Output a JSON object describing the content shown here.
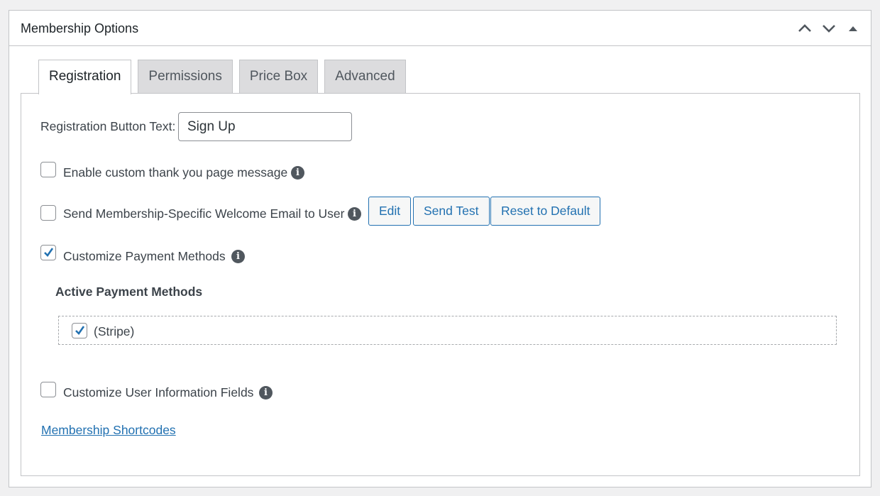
{
  "metabox": {
    "title": "Membership Options",
    "controls": [
      "move-up",
      "move-down",
      "toggle-panel"
    ]
  },
  "tabs": [
    {
      "label": "Registration",
      "active": true
    },
    {
      "label": "Permissions",
      "active": false
    },
    {
      "label": "Price Box",
      "active": false
    },
    {
      "label": "Advanced",
      "active": false
    }
  ],
  "registration": {
    "button_text_label": "Registration Button Text:",
    "button_text_value": "Sign Up",
    "thank_you": {
      "label": "Enable custom thank you page message",
      "checked": false
    },
    "welcome_email": {
      "label": "Send Membership-Specific Welcome Email to User",
      "checked": false,
      "buttons": {
        "edit": "Edit",
        "send_test": "Send Test",
        "reset": "Reset to Default"
      }
    },
    "payment_methods": {
      "label": "Customize Payment Methods",
      "checked": true
    },
    "active_methods_title": "Active Payment Methods",
    "methods": [
      {
        "label": "(Stripe)",
        "checked": true
      }
    ],
    "user_info": {
      "label": "Customize User Information Fields",
      "checked": false
    },
    "shortcodes_link": "Membership Shortcodes"
  },
  "colors": {
    "accent": "#2271b1",
    "border": "#c3c4c7",
    "background": "#f0f0f1",
    "icon": "#50575e"
  },
  "icons": [
    "chevron-up-icon",
    "chevron-down-icon",
    "triangle-up-icon",
    "info-icon",
    "checkmark-icon"
  ]
}
